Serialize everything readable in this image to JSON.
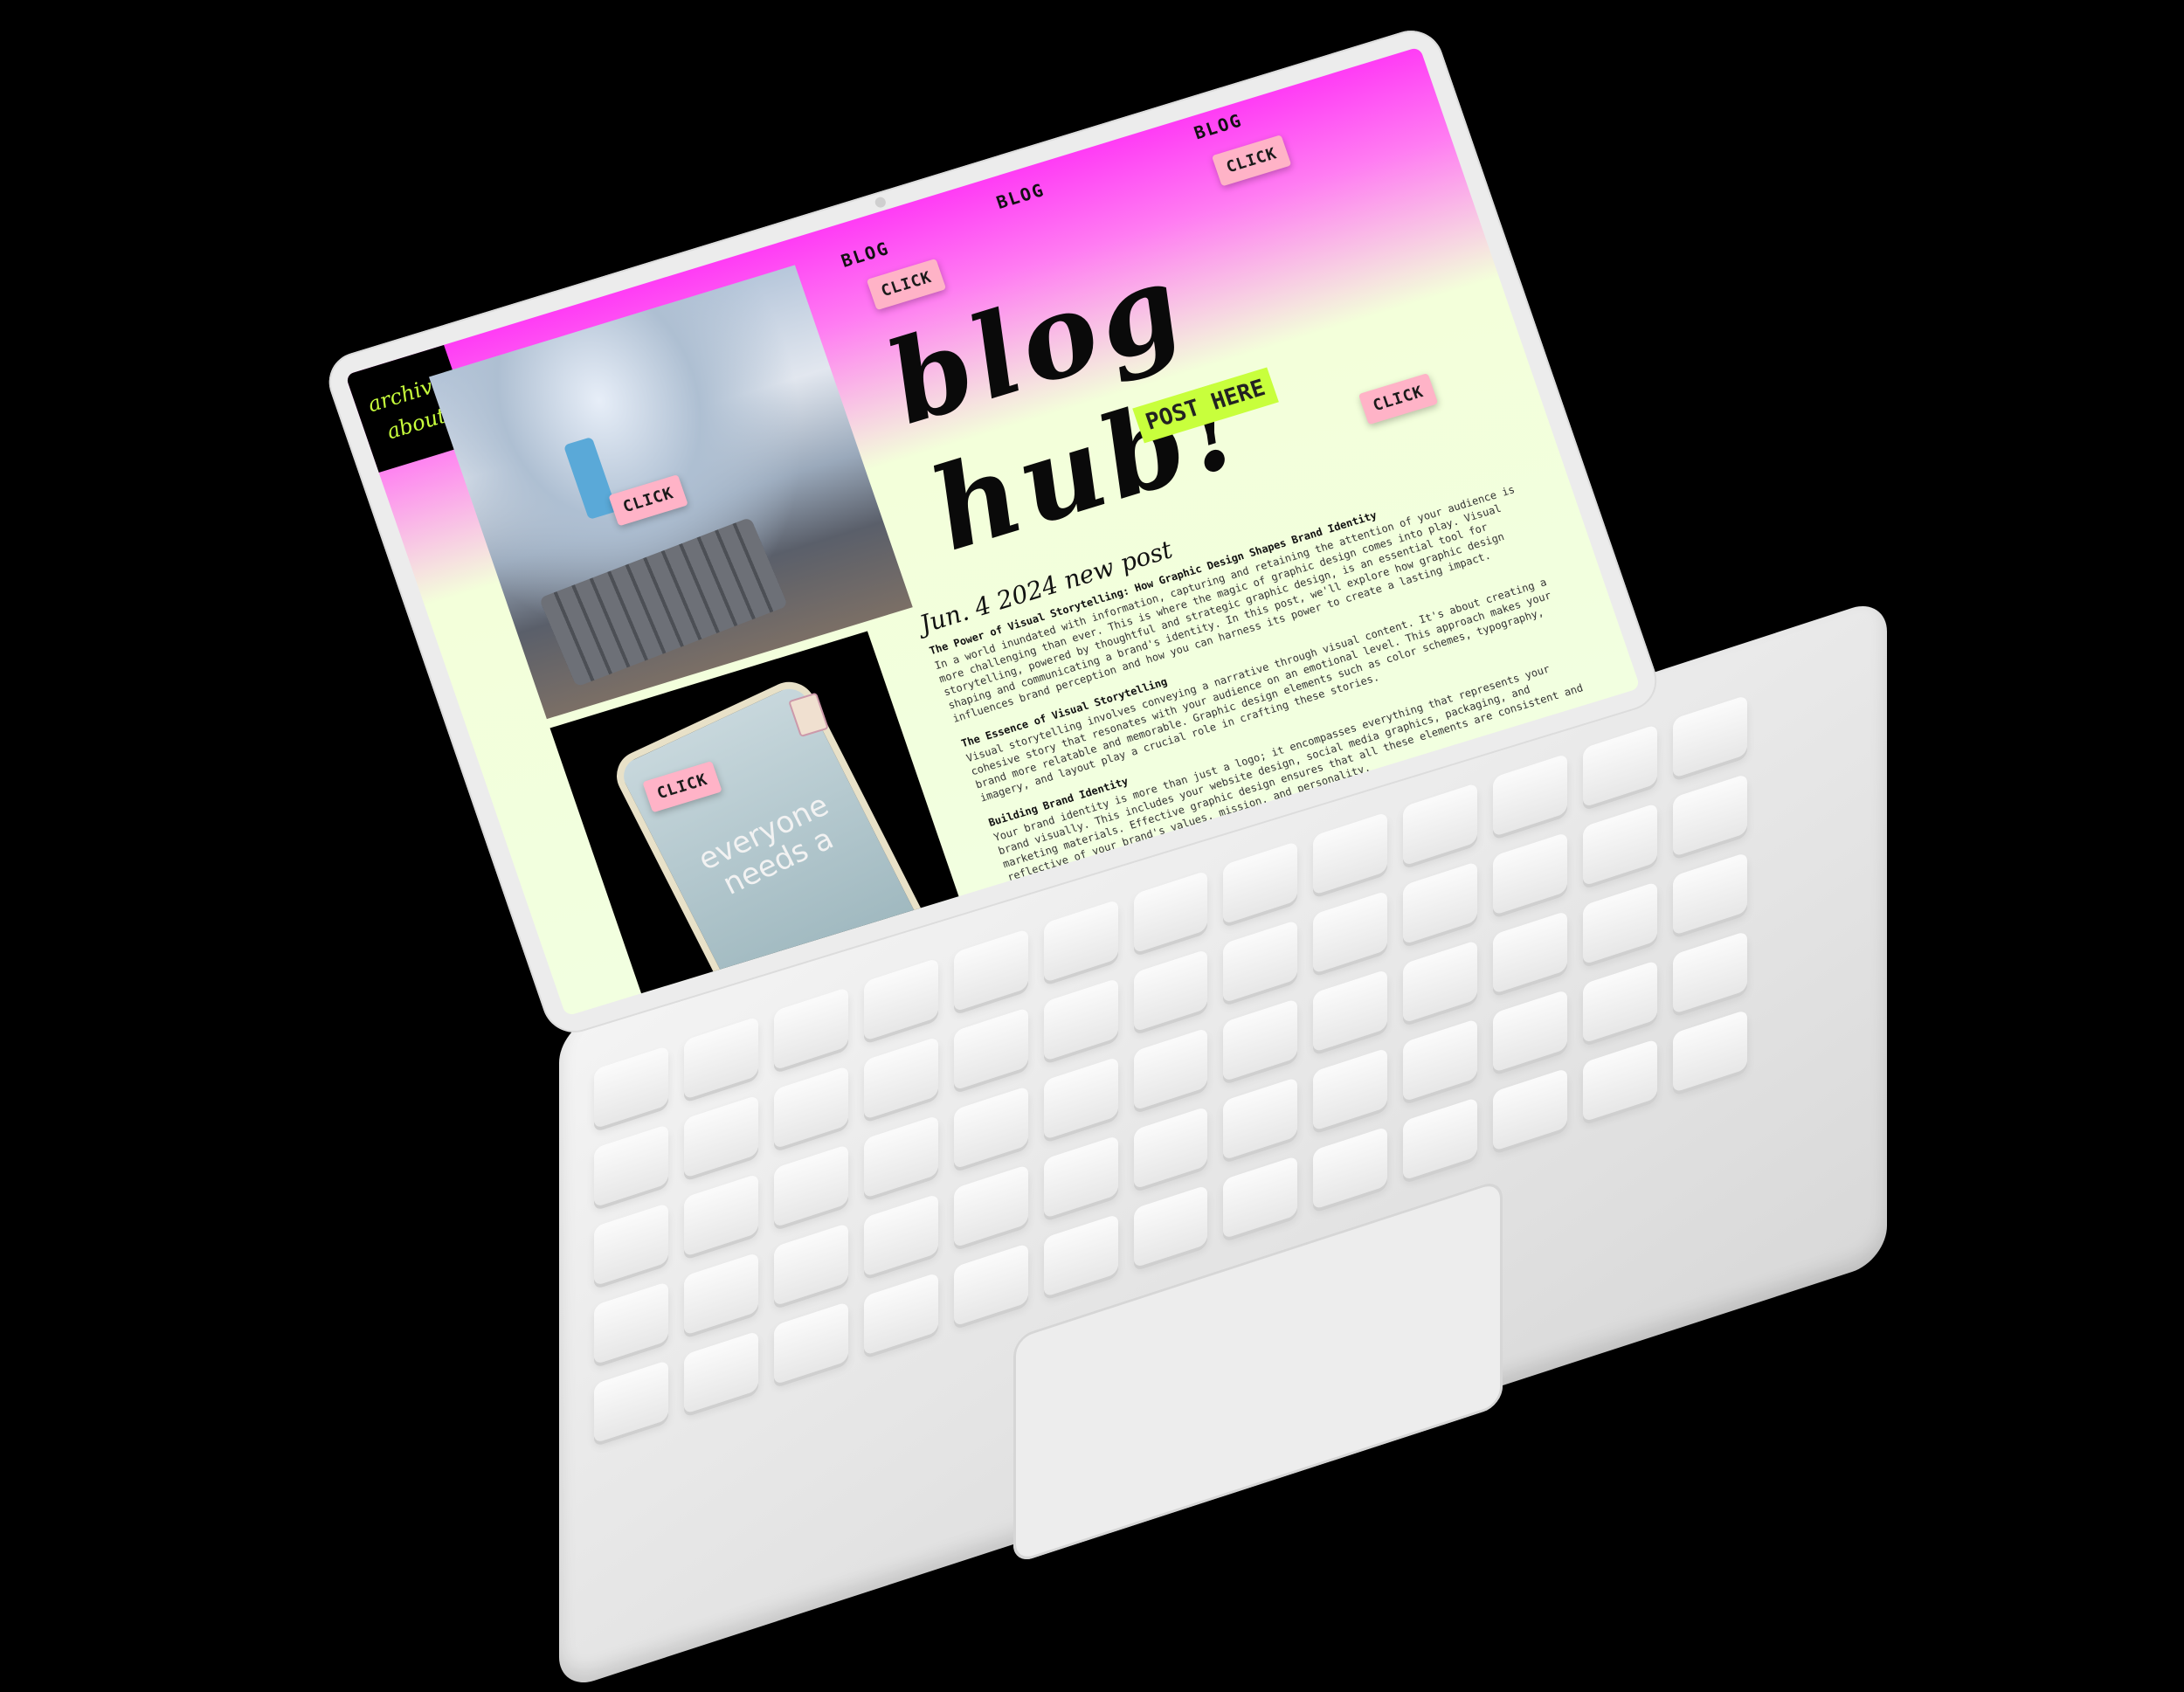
{
  "nav": {
    "archive": "archive",
    "about": "about"
  },
  "buttons": {
    "click": "CLICK",
    "blog": "BLOG"
  },
  "hero": {
    "title": "blog hub!",
    "badge": "POST HERE"
  },
  "post": {
    "date": "Jun. 4 2024 new post",
    "title": "The Power of Visual Storytelling: How Graphic Design Shapes Brand Identity",
    "intro": "In a world inundated with information, capturing and retaining the attention of your audience is more challenging than ever. This is where the magic of graphic design comes into play. Visual storytelling, powered by thoughtful and strategic graphic design, is an essential tool for shaping and communicating a brand's identity. In this post, we'll explore how graphic design influences brand perception and how you can harness its power to create a lasting impact.",
    "section1_title": "The Essence of Visual Storytelling",
    "section1_body": "Visual storytelling involves conveying a narrative through visual content. It's about creating a cohesive story that resonates with your audience on an emotional level. This approach makes your brand more relatable and memorable. Graphic design elements such as color schemes, typography, imagery, and layout play a crucial role in crafting these stories.",
    "section2_title": "Building Brand Identity",
    "section2_body": "Your brand identity is more than just a logo; it encompasses everything that represents your brand visually. This includes your website design, social media graphics, packaging, and marketing materials. Effective graphic design ensures that all these elements are consistent and reflective of your brand's values, mission, and personality."
  },
  "images": {
    "tank_text": "everyone needs a"
  },
  "colors": {
    "accent_pink": "#ff3cf5",
    "accent_lime": "#c8ff3c",
    "button_pink": "#ffb3c7",
    "background": "#f2ffe0"
  }
}
